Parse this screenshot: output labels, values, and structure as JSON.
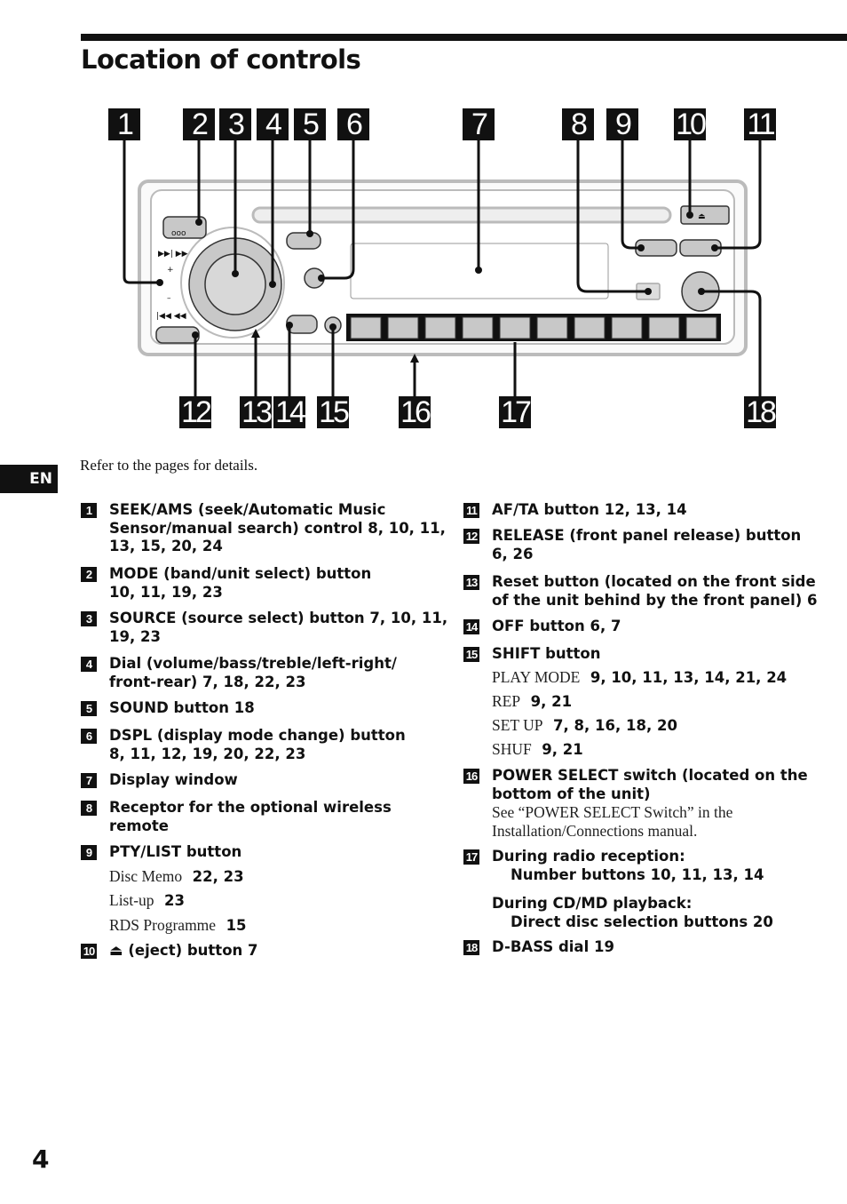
{
  "title": "Location of controls",
  "intro": "Refer to the pages for details.",
  "language_tab": "EN",
  "page_number": "4",
  "diagram": {
    "callouts_top": [
      "1",
      "2",
      "3",
      "4",
      "5",
      "6",
      "7",
      "8",
      "9",
      "10",
      "11"
    ],
    "callouts_bottom": [
      "12",
      "13",
      "14",
      "15",
      "16",
      "17",
      "18"
    ]
  },
  "left_items": [
    {
      "num": "1",
      "lines": [
        "SEEK/AMS (seek/Automatic Music",
        "Sensor/manual search) control  8, 10, 11,",
        "13, 15, 20, 24"
      ]
    },
    {
      "num": "2",
      "lines": [
        "MODE (band/unit select) button",
        "10, 11, 19, 23"
      ]
    },
    {
      "num": "3",
      "lines": [
        "SOURCE (source select) button  7, 10, 11,",
        "19, 23"
      ]
    },
    {
      "num": "4",
      "lines": [
        "Dial (volume/bass/treble/left-right/",
        "front-rear)  7, 18, 22, 23"
      ]
    },
    {
      "num": "5",
      "lines": [
        "SOUND button  18"
      ]
    },
    {
      "num": "6",
      "lines": [
        "DSPL (display mode change) button",
        "8, 11, 12, 19, 20, 22, 23"
      ]
    },
    {
      "num": "7",
      "lines": [
        "Display window"
      ]
    },
    {
      "num": "8",
      "lines": [
        "Receptor for the optional wireless",
        "remote"
      ]
    },
    {
      "num": "9",
      "lines": [
        "PTY/LIST button"
      ]
    },
    {
      "num": "10",
      "lines": [
        "⏏ (eject) button  7"
      ]
    }
  ],
  "left_subs": [
    {
      "label": "Disc Memo",
      "pages": "22, 23"
    },
    {
      "label": "List-up",
      "pages": "23"
    },
    {
      "label": "RDS Programme",
      "pages": "15"
    }
  ],
  "right_items": [
    {
      "num": "11",
      "lines": [
        "AF/TA button  12, 13, 14"
      ]
    },
    {
      "num": "12",
      "lines": [
        "RELEASE (front panel release) button",
        "6, 26"
      ]
    },
    {
      "num": "13",
      "lines": [
        "Reset button (located on the front side",
        "of the unit behind by the front panel)  6"
      ]
    },
    {
      "num": "14",
      "lines": [
        "OFF button  6, 7"
      ]
    },
    {
      "num": "15",
      "lines": [
        "SHIFT button"
      ]
    },
    {
      "num": "16",
      "lines": [
        "POWER SELECT switch (located on the",
        "bottom of the unit)"
      ],
      "note": [
        "See “POWER SELECT Switch” in the",
        "Installation/Connections manual."
      ]
    },
    {
      "num": "17",
      "lines": [
        "During radio reception:"
      ]
    },
    {
      "num": "18",
      "lines": [
        "D-BASS dial  19"
      ]
    }
  ],
  "right_subs": [
    {
      "label": "PLAY MODE",
      "pages": "9, 10, 11, 13, 14, 21, 24"
    },
    {
      "label": "REP",
      "pages": "9, 21"
    },
    {
      "label": "SET UP",
      "pages": "7, 8, 16, 18, 20"
    },
    {
      "label": "SHUF",
      "pages": "9, 21"
    }
  ],
  "item17_extra": {
    "radio_sub": "Number buttons  10, 11, 13, 14",
    "cd_heading": "During CD/MD playback:",
    "cd_sub": "Direct disc selection buttons  20"
  }
}
